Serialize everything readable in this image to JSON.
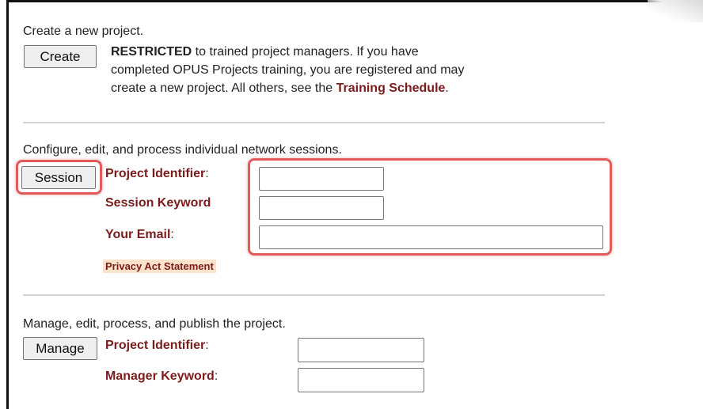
{
  "create": {
    "heading": "Create a new project.",
    "button_label": "Create",
    "line1_bold": "RESTRICTED",
    "line1_rest": " to trained project managers. If you have",
    "line2": "completed OPUS Projects training, you are registered and may",
    "line3_pre": "create a new project. All others, see the ",
    "line3_link": "Training Schedule",
    "line3_post": "."
  },
  "session": {
    "heading": "Configure, edit, and process individual network sessions.",
    "button_label": "Session",
    "project_identifier_label": "Project Identifier",
    "session_keyword_label": "Session Keyword",
    "your_email_label": "Your Email",
    "colon": ":",
    "project_identifier_value": "",
    "session_keyword_value": "",
    "email_value": "",
    "privacy_link": "Privacy Act Statement"
  },
  "manage": {
    "heading": "Manage, edit, process, and publish the project.",
    "button_label": "Manage",
    "project_identifier_label": "Project Identifier",
    "manager_keyword_label": "Manager Keyword",
    "colon": ":",
    "project_identifier_value": "",
    "manager_keyword_value": ""
  },
  "colors": {
    "label_red": "#7a1c1c",
    "highlight": "#e25a5a",
    "privacy_bg": "#fbe3c9"
  }
}
